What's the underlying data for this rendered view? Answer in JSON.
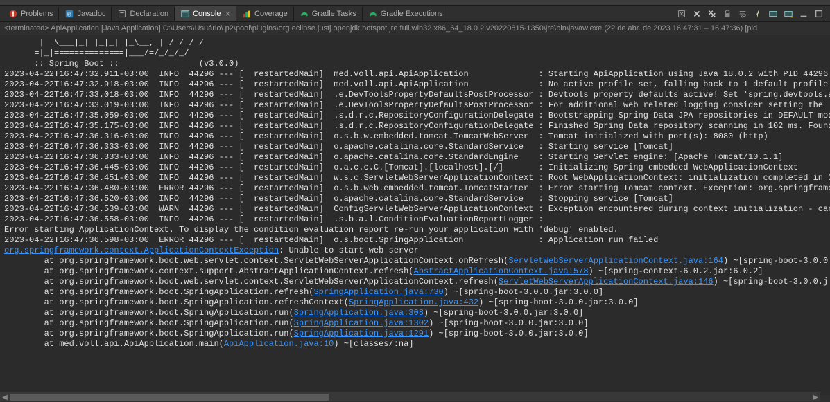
{
  "tabs": [
    {
      "label": "Problems",
      "icon": "problems"
    },
    {
      "label": "Javadoc",
      "icon": "javadoc"
    },
    {
      "label": "Declaration",
      "icon": "declaration"
    },
    {
      "label": "Console",
      "icon": "console",
      "active": true
    },
    {
      "label": "Coverage",
      "icon": "coverage"
    },
    {
      "label": "Gradle Tasks",
      "icon": "gradle"
    },
    {
      "label": "Gradle Executions",
      "icon": "gradle"
    }
  ],
  "terminated": {
    "prefix": "<terminated>",
    "app": "ApiApplication [Java Application]",
    "path": "C:\\Users\\Usuário\\.p2\\pool\\plugins\\org.eclipse.justj.openjdk.hotspot.jre.full.win32.x86_64_18.0.2.v20220815-1350\\jre\\bin\\javaw.exe",
    "timestamp": "(22 de abr. de 2023 16:47:31 – 16:47:36) [pid"
  },
  "ascii": [
    "       |  \\___|_| |_|_| |_\\__, | / / / /",
    "      =|_|==============|___/=/_/_/_/",
    "      :: Spring Boot ::                (v3.0.0)",
    ""
  ],
  "logs": [
    {
      "ts": "2023-04-22T16:47:32.911-03:00",
      "lvl": "INFO",
      "pid": "44296",
      "sep": "--- [",
      "thread": "restartedMain]",
      "logger": "med.voll.api.ApiApplication",
      "msg": "Starting ApiApplication using Java 18.0.2 with PID 44296 ("
    },
    {
      "ts": "2023-04-22T16:47:32.918-03:00",
      "lvl": "INFO",
      "pid": "44296",
      "sep": "--- [",
      "thread": "restartedMain]",
      "logger": "med.voll.api.ApiApplication",
      "msg": "No active profile set, falling back to 1 default profile:"
    },
    {
      "ts": "2023-04-22T16:47:33.018-03:00",
      "lvl": "INFO",
      "pid": "44296",
      "sep": "--- [",
      "thread": "restartedMain]",
      "logger": ".e.DevToolsPropertyDefaultsPostProcessor",
      "msg": "Devtools property defaults active! Set 'spring.devtools.ad"
    },
    {
      "ts": "2023-04-22T16:47:33.019-03:00",
      "lvl": "INFO",
      "pid": "44296",
      "sep": "--- [",
      "thread": "restartedMain]",
      "logger": ".e.DevToolsPropertyDefaultsPostProcessor",
      "msg": "For additional web related logging consider setting the 'l"
    },
    {
      "ts": "2023-04-22T16:47:35.059-03:00",
      "lvl": "INFO",
      "pid": "44296",
      "sep": "--- [",
      "thread": "restartedMain]",
      "logger": ".s.d.r.c.RepositoryConfigurationDelegate",
      "msg": "Bootstrapping Spring Data JPA repositories in DEFAULT mode"
    },
    {
      "ts": "2023-04-22T16:47:35.175-03:00",
      "lvl": "INFO",
      "pid": "44296",
      "sep": "--- [",
      "thread": "restartedMain]",
      "logger": ".s.d.r.c.RepositoryConfigurationDelegate",
      "msg": "Finished Spring Data repository scanning in 102 ms. Found "
    },
    {
      "ts": "2023-04-22T16:47:36.316-03:00",
      "lvl": "INFO",
      "pid": "44296",
      "sep": "--- [",
      "thread": "restartedMain]",
      "logger": "o.s.b.w.embedded.tomcat.TomcatWebServer",
      "msg": "Tomcat initialized with port(s): 8080 (http)"
    },
    {
      "ts": "2023-04-22T16:47:36.333-03:00",
      "lvl": "INFO",
      "pid": "44296",
      "sep": "--- [",
      "thread": "restartedMain]",
      "logger": "o.apache.catalina.core.StandardService",
      "msg": "Starting service [Tomcat]"
    },
    {
      "ts": "2023-04-22T16:47:36.333-03:00",
      "lvl": "INFO",
      "pid": "44296",
      "sep": "--- [",
      "thread": "restartedMain]",
      "logger": "o.apache.catalina.core.StandardEngine",
      "msg": "Starting Servlet engine: [Apache Tomcat/10.1.1]"
    },
    {
      "ts": "2023-04-22T16:47:36.445-03:00",
      "lvl": "INFO",
      "pid": "44296",
      "sep": "--- [",
      "thread": "restartedMain]",
      "logger": "o.a.c.c.C.[Tomcat].[localhost].[/]",
      "msg": "Initializing Spring embedded WebApplicationContext"
    },
    {
      "ts": "2023-04-22T16:47:36.451-03:00",
      "lvl": "INFO",
      "pid": "44296",
      "sep": "--- [",
      "thread": "restartedMain]",
      "logger": "w.s.c.ServletWebServerApplicationContext",
      "msg": "Root WebApplicationContext: initialization completed in 34"
    },
    {
      "ts": "2023-04-22T16:47:36.480-03:00",
      "lvl": "ERROR",
      "pid": "44296",
      "sep": "--- [",
      "thread": "restartedMain]",
      "logger": "o.s.b.web.embedded.tomcat.TomcatStarter",
      "msg": "Error starting Tomcat context. Exception: org.springframew"
    },
    {
      "ts": "2023-04-22T16:47:36.520-03:00",
      "lvl": "INFO",
      "pid": "44296",
      "sep": "--- [",
      "thread": "restartedMain]",
      "logger": "o.apache.catalina.core.StandardService",
      "msg": "Stopping service [Tomcat]"
    },
    {
      "ts": "2023-04-22T16:47:36.539-03:00",
      "lvl": "WARN",
      "pid": "44296",
      "sep": "--- [",
      "thread": "restartedMain]",
      "logger": "ConfigServletWebServerApplicationContext",
      "msg": "Exception encountered during context initialization - canc"
    },
    {
      "ts": "2023-04-22T16:47:36.558-03:00",
      "lvl": "INFO",
      "pid": "44296",
      "sep": "--- [",
      "thread": "restartedMain]",
      "logger": ".s.b.a.l.ConditionEvaluationReportLogger",
      "msg": ""
    }
  ],
  "blank1": "",
  "errorMsg": "Error starting ApplicationContext. To display the condition evaluation report re-run your application with 'debug' enabled.",
  "failLog": {
    "ts": "2023-04-22T16:47:36.598-03:00",
    "lvl": "ERROR",
    "pid": "44296",
    "sep": "--- [",
    "thread": "restartedMain]",
    "logger": "o.s.boot.SpringApplication",
    "msg": "Application run failed"
  },
  "blank2": "",
  "exception": {
    "header_link": "org.springframework.context.ApplicationContextException",
    "header_rest": ": Unable to start web server",
    "frames": [
      {
        "pre": "        at org.springframework.boot.web.servlet.context.ServletWebServerApplicationContext.onRefresh(",
        "link": "ServletWebServerApplicationContext.java:164",
        "post": ") ~[spring-boot-3.0.0"
      },
      {
        "pre": "        at org.springframework.context.support.AbstractApplicationContext.refresh(",
        "link": "AbstractApplicationContext.java:578",
        "post": ") ~[spring-context-6.0.2.jar:6.0.2]"
      },
      {
        "pre": "        at org.springframework.boot.web.servlet.context.ServletWebServerApplicationContext.refresh(",
        "link": "ServletWebServerApplicationContext.java:146",
        "post": ") ~[spring-boot-3.0.0.j"
      },
      {
        "pre": "        at org.springframework.boot.SpringApplication.refresh(",
        "link": "SpringApplication.java:730",
        "post": ") ~[spring-boot-3.0.0.jar:3.0.0]"
      },
      {
        "pre": "        at org.springframework.boot.SpringApplication.refreshContext(",
        "link": "SpringApplication.java:432",
        "post": ") ~[spring-boot-3.0.0.jar:3.0.0]"
      },
      {
        "pre": "        at org.springframework.boot.SpringApplication.run(",
        "link": "SpringApplication.java:308",
        "post": ") ~[spring-boot-3.0.0.jar:3.0.0]"
      },
      {
        "pre": "        at org.springframework.boot.SpringApplication.run(",
        "link": "SpringApplication.java:1302",
        "post": ") ~[spring-boot-3.0.0.jar:3.0.0]"
      },
      {
        "pre": "        at org.springframework.boot.SpringApplication.run(",
        "link": "SpringApplication.java:1291",
        "post": ") ~[spring-boot-3.0.0.jar:3.0.0]"
      },
      {
        "pre": "        at med.voll.api.ApiApplication.main(",
        "link": "ApiApplication.java:10",
        "post": ") ~[classes/:na]"
      }
    ]
  }
}
